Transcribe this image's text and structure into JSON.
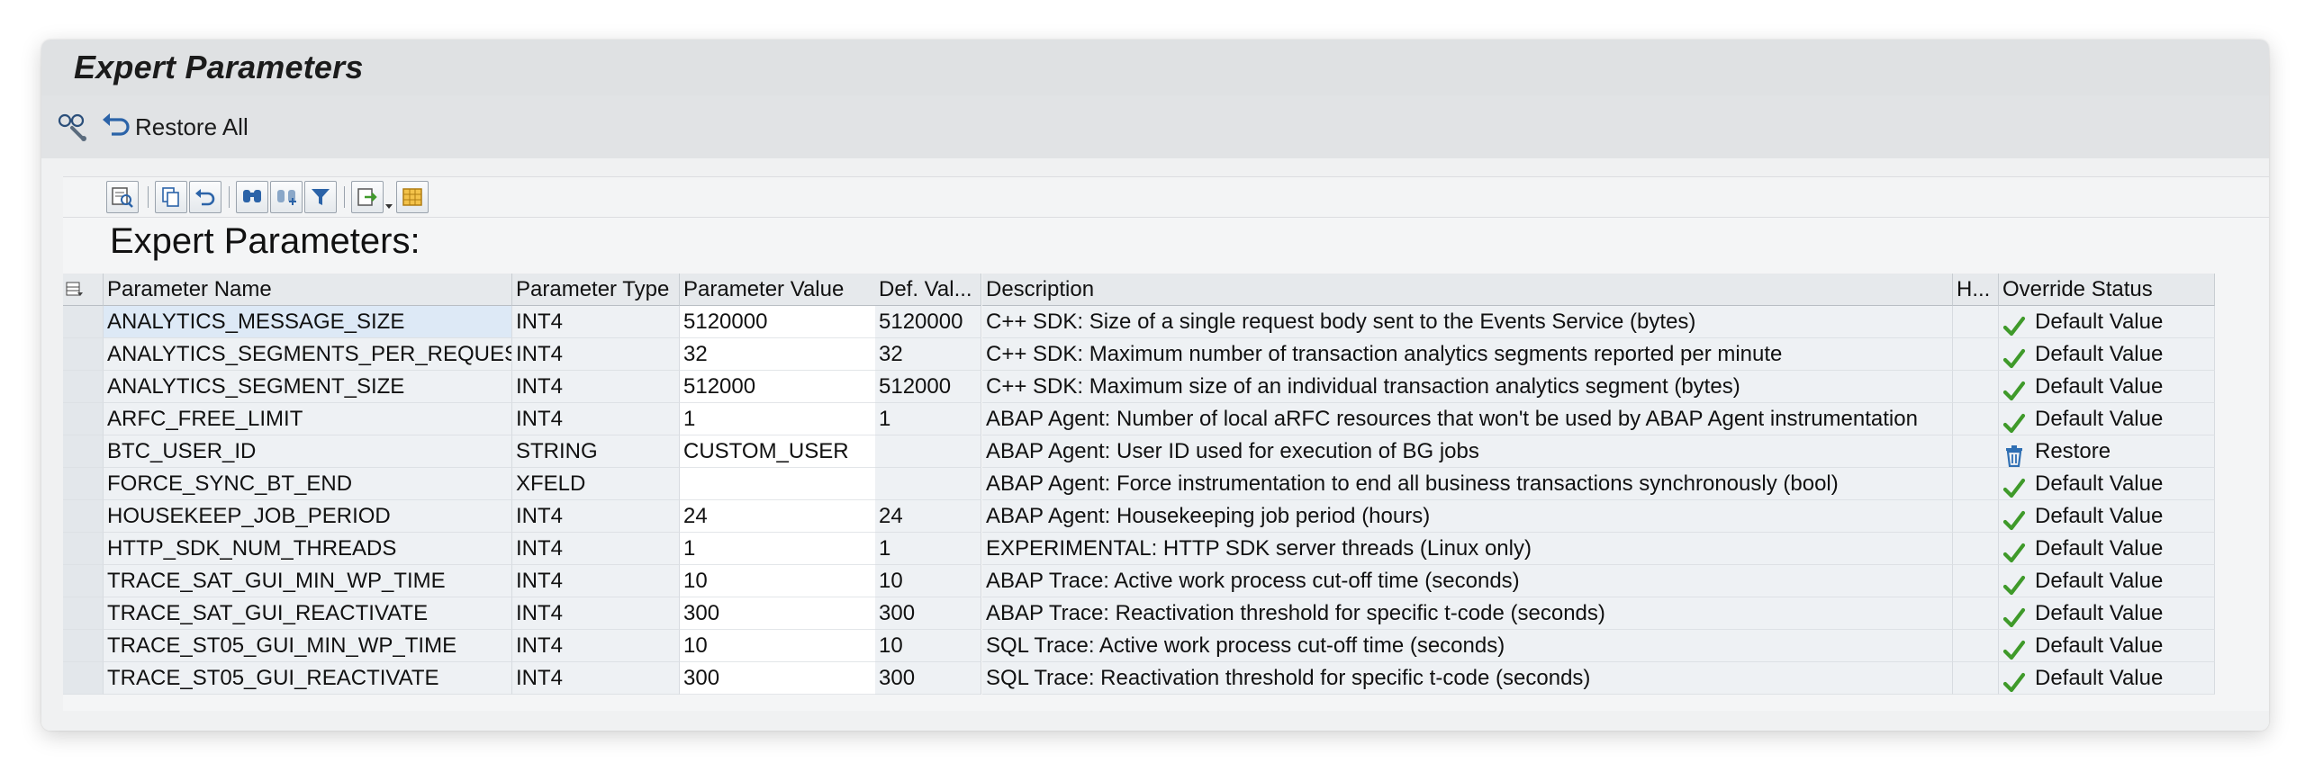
{
  "window": {
    "title": "Expert Parameters"
  },
  "app_toolbar": {
    "settings_icon": "wrench-glasses-icon",
    "restore_all_icon": "undo-icon",
    "restore_all_label": "Restore All"
  },
  "alv_toolbar": {
    "buttons": [
      "details-icon",
      "copy-icon",
      "undo-icon",
      "find-icon",
      "find-next-icon",
      "filter-icon",
      "export-icon",
      "layout-icon"
    ]
  },
  "grid": {
    "title": "Expert Parameters:",
    "columns": [
      "Parameter Name",
      "Parameter Type",
      "Parameter Value",
      "Def. Val...",
      "Description",
      "H...",
      "Override Status"
    ],
    "rows": [
      {
        "name": "ANALYTICS_MESSAGE_SIZE",
        "type": "INT4",
        "value": "5120000",
        "default": "5120000",
        "description": "C++ SDK: Size of a single request body sent to the Events Service (bytes)",
        "h": "",
        "status": "Default Value",
        "status_icon": "checkmark-icon"
      },
      {
        "name": "ANALYTICS_SEGMENTS_PER_REQUEST",
        "type": "INT4",
        "value": "32",
        "default": "32",
        "description": "C++ SDK: Maximum number of transaction analytics segments reported per minute",
        "h": "",
        "status": "Default Value",
        "status_icon": "checkmark-icon"
      },
      {
        "name": "ANALYTICS_SEGMENT_SIZE",
        "type": "INT4",
        "value": "512000",
        "default": "512000",
        "description": "C++ SDK: Maximum size of an individual transaction analytics segment (bytes)",
        "h": "",
        "status": "Default Value",
        "status_icon": "checkmark-icon"
      },
      {
        "name": "ARFC_FREE_LIMIT",
        "type": "INT4",
        "value": "1",
        "default": "1",
        "description": "ABAP Agent: Number of local aRFC resources that won't be used by ABAP Agent instrumentation",
        "h": "",
        "status": "Default Value",
        "status_icon": "checkmark-icon"
      },
      {
        "name": "BTC_USER_ID",
        "type": "STRING",
        "value": "CUSTOM_USER",
        "default": "",
        "description": "ABAP Agent: User ID used for execution of BG jobs",
        "h": "",
        "status": "Restore",
        "status_icon": "trash-icon"
      },
      {
        "name": "FORCE_SYNC_BT_END",
        "type": "XFELD",
        "value": "",
        "default": "",
        "description": "ABAP Agent: Force instrumentation to end all business transactions synchronously (bool)",
        "h": "",
        "status": "Default Value",
        "status_icon": "checkmark-icon"
      },
      {
        "name": "HOUSEKEEP_JOB_PERIOD",
        "type": "INT4",
        "value": "24",
        "default": "24",
        "description": "ABAP Agent: Housekeeping job period (hours)",
        "h": "",
        "status": "Default Value",
        "status_icon": "checkmark-icon"
      },
      {
        "name": "HTTP_SDK_NUM_THREADS",
        "type": "INT4",
        "value": "1",
        "default": "1",
        "description": "EXPERIMENTAL: HTTP SDK server threads (Linux only)",
        "h": "",
        "status": "Default Value",
        "status_icon": "checkmark-icon"
      },
      {
        "name": "TRACE_SAT_GUI_MIN_WP_TIME",
        "type": "INT4",
        "value": "10",
        "default": "10",
        "description": "ABAP Trace: Active work process cut-off time (seconds)",
        "h": "",
        "status": "Default Value",
        "status_icon": "checkmark-icon"
      },
      {
        "name": "TRACE_SAT_GUI_REACTIVATE",
        "type": "INT4",
        "value": "300",
        "default": "300",
        "description": "ABAP Trace: Reactivation threshold for specific t-code (seconds)",
        "h": "",
        "status": "Default Value",
        "status_icon": "checkmark-icon"
      },
      {
        "name": "TRACE_ST05_GUI_MIN_WP_TIME",
        "type": "INT4",
        "value": "10",
        "default": "10",
        "description": "SQL Trace: Active work process cut-off time (seconds)",
        "h": "",
        "status": "Default Value",
        "status_icon": "checkmark-icon"
      },
      {
        "name": "TRACE_ST05_GUI_REACTIVATE",
        "type": "INT4",
        "value": "300",
        "default": "300",
        "description": "SQL Trace: Reactivation threshold for specific t-code (seconds)",
        "h": "",
        "status": "Default Value",
        "status_icon": "checkmark-icon"
      }
    ]
  },
  "colors": {
    "checkmark": "#3f9a2a",
    "trash": "#2f6fb3",
    "header_bg": "#e6e9ec",
    "selected_cell": "#dde9f6"
  }
}
